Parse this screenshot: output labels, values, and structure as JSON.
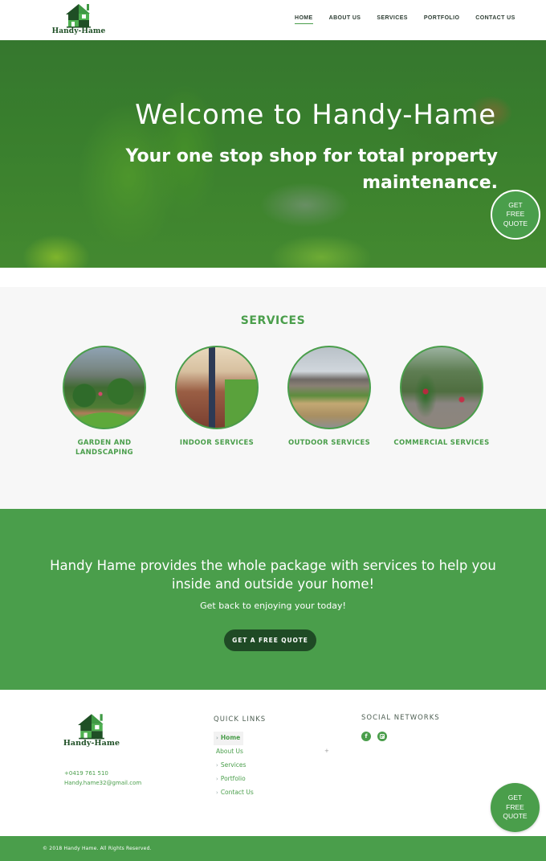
{
  "brand": {
    "name": "Handy-Hame",
    "colors": {
      "primary": "#4a9e4b",
      "dark": "#1f4a25",
      "light_bg": "#f7f7f7"
    }
  },
  "header": {
    "nav": [
      {
        "label": "HOME",
        "active": true
      },
      {
        "label": "ABOUT US",
        "active": false
      },
      {
        "label": "SERVICES",
        "active": false
      },
      {
        "label": "PORTFOLIO",
        "active": false
      },
      {
        "label": "CONTACT US",
        "active": false
      }
    ]
  },
  "hero": {
    "title": "Welcome to Handy-Hame",
    "subtitle": "Your one stop shop for total property maintenance.",
    "quote_bubble": [
      "GET",
      "FREE",
      "QUOTE"
    ]
  },
  "services": {
    "title": "SERVICES",
    "items": [
      {
        "label": "GARDEN AND LANDSCAPING",
        "image": "garden-photo"
      },
      {
        "label": "INDOOR SERVICES",
        "image": "indoor-photo"
      },
      {
        "label": "OUTDOOR SERVICES",
        "image": "outdoor-photo"
      },
      {
        "label": "COMMERCIAL SERVICES",
        "image": "commercial-photo"
      }
    ]
  },
  "cta": {
    "title": "Handy Hame provides the whole package with services to help you inside and outside your home!",
    "subtitle": "Get back to enjoying your today!",
    "button": "GET A FREE QUOTE"
  },
  "footer": {
    "phone": "+0419 761 510",
    "email": "Handy.hame32@gmail.com",
    "quick_links_heading": "QUICK LINKS",
    "quick_links": [
      {
        "label": "Home",
        "chevron": true,
        "active": true
      },
      {
        "label": "About Us",
        "chevron": false,
        "active": false
      },
      {
        "label": "Services",
        "chevron": true,
        "active": false
      },
      {
        "label": "Portfolio",
        "chevron": true,
        "active": false
      },
      {
        "label": "Contact Us",
        "chevron": true,
        "active": false
      }
    ],
    "social_heading": "SOCIAL NETWORKS",
    "social": [
      {
        "name": "facebook",
        "glyph": "f"
      },
      {
        "name": "instagram",
        "glyph": ""
      }
    ],
    "floating_quote": [
      "GET",
      "FREE",
      "QUOTE"
    ],
    "copyright": "© 2018 Handy Hame. All Rights Reserved."
  }
}
